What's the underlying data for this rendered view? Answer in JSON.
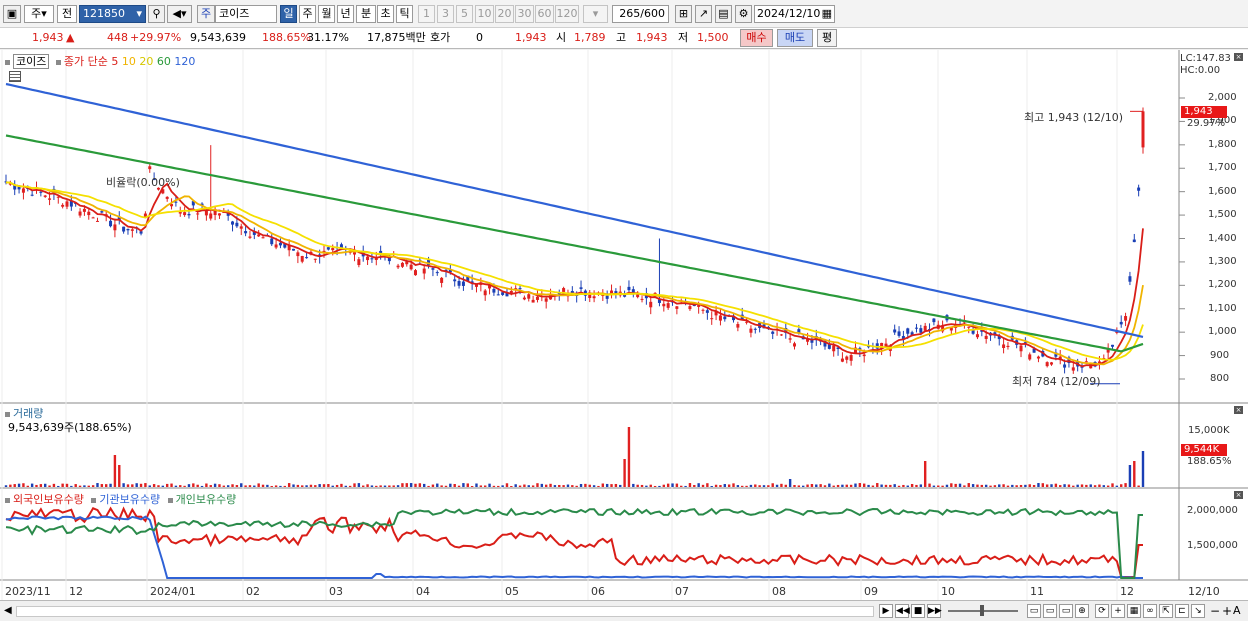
{
  "toolbar": {
    "type_label": "주",
    "prev_label": "전",
    "code_value": "121850",
    "market_label": "주",
    "stock_name": "코이즈",
    "periods": [
      "일",
      "주",
      "월",
      "년",
      "분",
      "초",
      "틱"
    ],
    "active_period": "일",
    "intervals": [
      "1",
      "3",
      "5",
      "10",
      "20",
      "30",
      "60",
      "120"
    ],
    "count_value": "265",
    "count_total": "/600",
    "date_value": "2024/12/10"
  },
  "quote": {
    "price": "1,943",
    "change": "448",
    "change_pct": "+29.97%",
    "volume": "9,543,639",
    "volume_ratio": "188.65%",
    "turnover": "31.17%",
    "trade_value": "17,875백만",
    "hoga_label": "호가",
    "hoga_value": "0",
    "hoga_price": "1,943",
    "open_label": "시",
    "open": "1,789",
    "high_label": "고",
    "high": "1,943",
    "low_label": "저",
    "low": "1,500",
    "buy_label": "매수",
    "sell_label": "매도",
    "avg_label": "평"
  },
  "price_pane": {
    "title": "코이즈",
    "ma_label": "종가 단순",
    "ma_periods": [
      "5",
      "10",
      "20",
      "60",
      "120"
    ],
    "ma_colors": [
      "#d91e18",
      "#f0b400",
      "#f5e000",
      "#2a9a3a",
      "#2f62d6"
    ],
    "lc_label": "LC:147.83",
    "hc_label": "HC:0.00",
    "y_ticks": [
      "2,000",
      "1,900",
      "1,800",
      "1,700",
      "1,600",
      "1,500",
      "1,400",
      "1,300",
      "1,200",
      "1,100",
      "1,000",
      "900",
      "800"
    ],
    "current_price_tag": "1,943",
    "current_pct_tag": "29.97%",
    "high_annotation": "최고 1,943 (12/10)",
    "low_annotation": "최저 784 (12/09)",
    "event_annotation": "비율락(0.00%)"
  },
  "volume_pane": {
    "title": "거래량",
    "value_line": "9,543,639주(188.65%)",
    "y_tick": "15,000K",
    "value_tag": "9,544K",
    "pct_tag": "188.65%"
  },
  "holding_pane": {
    "series": [
      "외국인보유수량",
      "기관보유수량",
      "개인보유수량"
    ],
    "series_colors": [
      "#d91e18",
      "#2f62d6",
      "#2a8a4a"
    ],
    "y_ticks": [
      "2,000,000",
      "1,500,000"
    ]
  },
  "x_axis": [
    "2023/11",
    "12",
    "2024/01",
    "02",
    "03",
    "04",
    "05",
    "06",
    "07",
    "08",
    "09",
    "10",
    "11",
    "12",
    "12/10"
  ],
  "icons": [
    "chart-settings-icon",
    "search-icon",
    "speaker-icon",
    "calendar-icon",
    "gear-icon",
    "save-icon"
  ]
}
